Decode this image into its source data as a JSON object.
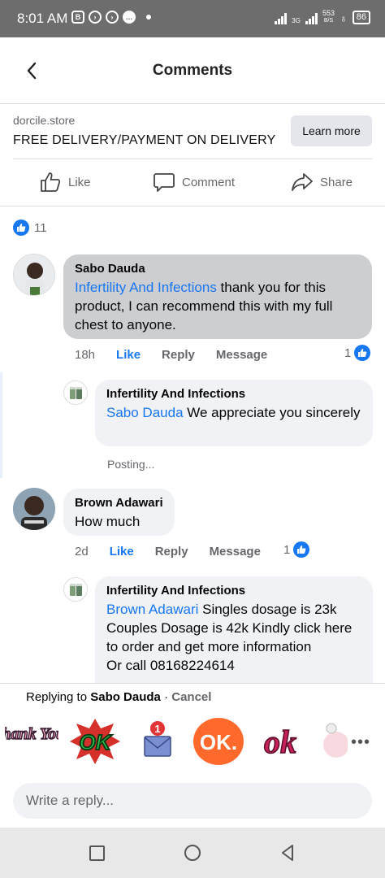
{
  "status_bar": {
    "time": "8:01 AM",
    "net_top": "3G",
    "speed_top": "553",
    "speed_unit": "B/S",
    "battery": "86"
  },
  "header": {
    "title": "Comments"
  },
  "ad": {
    "domain": "dorcile.store",
    "headline": "FREE DELIVERY/PAYMENT ON  DELIVERY",
    "cta": "Learn more"
  },
  "actions": {
    "like": "Like",
    "comment": "Comment",
    "share": "Share"
  },
  "reactions": {
    "count": "11"
  },
  "comments": [
    {
      "author": "Sabo Dauda",
      "mention": "Infertility And Infections",
      "text": " thank you for this product, I can recommend this with my full chest to anyone.",
      "age": "18h",
      "like": "Like",
      "reply": "Reply",
      "message": "Message",
      "reaction_count": "1"
    },
    {
      "author": "Infertility And Infections",
      "mention": "Sabo Dauda",
      "text": " We appreciate you sincerely",
      "status": "Posting..."
    },
    {
      "author": "Brown Adawari",
      "text": "How much",
      "age": "2d",
      "like": "Like",
      "reply": "Reply",
      "message": "Message",
      "reaction_count": "1"
    },
    {
      "author": "Infertility And Infections",
      "mention": "Brown Adawari",
      "text": " Singles dosage is 23k Couples Dosage is 42k Kindly click here to order and get more information",
      "text_cut": "Or call 08168224614"
    }
  ],
  "replying": {
    "prefix": "Replying to ",
    "name": "Sabo Dauda",
    "sep": " · ",
    "cancel": "Cancel"
  },
  "stickers": [
    {
      "name": "thank-you-sticker",
      "label": "Thank You!"
    },
    {
      "name": "ok-green-sticker",
      "label": "OK"
    },
    {
      "name": "mail-notification-sticker",
      "label": "1"
    },
    {
      "name": "ok-orange-sticker",
      "label": "OK."
    },
    {
      "name": "ok-pink-sticker",
      "label": "ok"
    }
  ],
  "input": {
    "placeholder": "Write a reply..."
  },
  "colors": {
    "accent": "#1877f2",
    "bubble": "#f0f2f5",
    "highlight_bubble": "#ccced2",
    "status_bar": "#6d6d6d"
  }
}
